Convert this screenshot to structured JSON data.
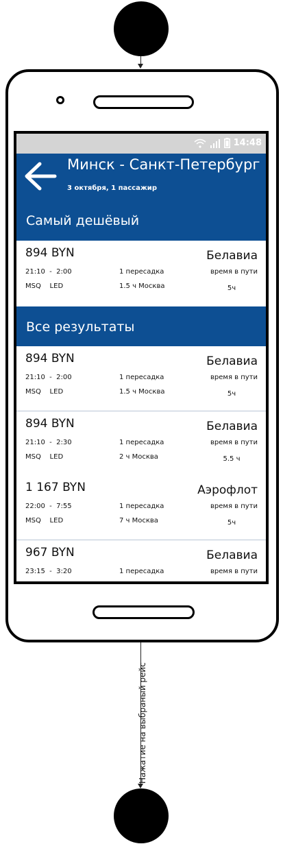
{
  "screen": {
    "status_bar": {
      "time": "14:48",
      "icons": [
        "wifi-icon",
        "signal-icon",
        "battery-icon"
      ]
    },
    "header": {
      "back_icon": "arrow-left-icon",
      "title": "Минск - Санкт-Петербург",
      "subtitle": "3 октября, 1 пассажир"
    },
    "cheapest_section": {
      "title": "Самый дешёвый",
      "flight": {
        "price": "894 BYN",
        "airline": "Белавиа",
        "times": "21:10  -  2:00",
        "codes": "MSQ    LED",
        "stops": "1 пересадка",
        "layover": "1.5 ч Москва",
        "duration_label": "время в пути",
        "duration": "5ч"
      }
    },
    "all_results_section": {
      "title": "Все результаты",
      "flights": [
        {
          "price": "894 BYN",
          "airline": "Белавиа",
          "times": "21:10  -  2:00",
          "codes": "MSQ    LED",
          "stops": "1 пересадка",
          "layover": "1.5 ч Москва",
          "duration_label": "время в пути",
          "duration": "5ч"
        },
        {
          "price": "894 BYN",
          "airline": "Белавиа",
          "times": "21:10  -  2:30",
          "codes": "MSQ    LED",
          "stops": "1 пересадка",
          "layover": "2 ч Москва",
          "duration_label": "время в пути",
          "duration": "5.5 ч"
        },
        {
          "price": "1 167 BYN",
          "airline": "Аэрофлот",
          "times": "22:00  -  7:55",
          "codes": "MSQ    LED",
          "stops": "1 пересадка",
          "layover": "7 ч Москва",
          "duration_label": "время в пути",
          "duration": "5ч"
        },
        {
          "price": "967 BYN",
          "airline": "Белавиа",
          "times": "23:15  -  3:20",
          "stops": "1 пересадка",
          "duration_label": "время в пути"
        }
      ]
    }
  },
  "flow": {
    "edge_label": "Нажатие на выбраный рейс"
  },
  "colors": {
    "primary": "#0d4f93",
    "status_bar": "#d4d4d4",
    "separator": "#b9c5d6"
  }
}
